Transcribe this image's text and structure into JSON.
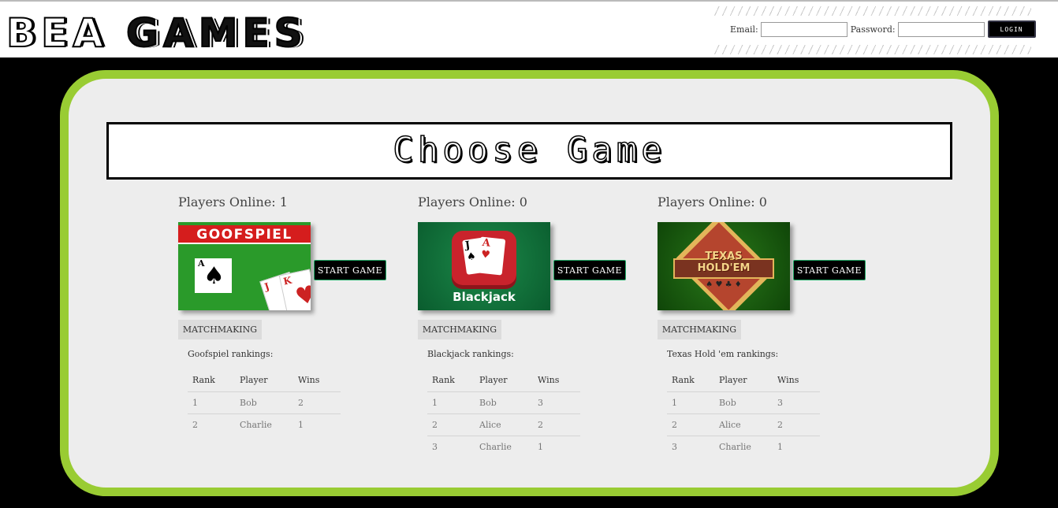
{
  "header": {
    "logo_text_1": "BEA",
    "logo_text_2": "GAMES",
    "email_label": "Email:",
    "email_value": "",
    "password_label": "Password:",
    "password_value": "",
    "login_button": "LOGIN"
  },
  "main": {
    "title": "Choose Game",
    "games": [
      {
        "players_online_label": "Players Online:",
        "players_online": "1",
        "thumbnail_text": "GOOFSPIEL",
        "start_button": "START GAME",
        "matchmaking_button": "MATCHMAKING",
        "rankings_title": "Goofspiel rankings:",
        "columns": [
          "Rank",
          "Player",
          "Wins"
        ],
        "rows": [
          [
            "1",
            "Bob",
            "2"
          ],
          [
            "2",
            "Charlie",
            "1"
          ]
        ]
      },
      {
        "players_online_label": "Players Online:",
        "players_online": "0",
        "thumbnail_text": "Blackjack",
        "start_button": "START GAME",
        "matchmaking_button": "MATCHMAKING",
        "rankings_title": "Blackjack rankings:",
        "columns": [
          "Rank",
          "Player",
          "Wins"
        ],
        "rows": [
          [
            "1",
            "Bob",
            "3"
          ],
          [
            "2",
            "Alice",
            "2"
          ],
          [
            "3",
            "Charlie",
            "1"
          ]
        ]
      },
      {
        "players_online_label": "Players Online:",
        "players_online": "0",
        "thumbnail_text_1": "TEXAS",
        "thumbnail_text_2": "HOLD'EM",
        "start_button": "START GAME",
        "matchmaking_button": "MATCHMAKING",
        "rankings_title": "Texas Hold 'em rankings:",
        "columns": [
          "Rank",
          "Player",
          "Wins"
        ],
        "rows": [
          [
            "1",
            "Bob",
            "3"
          ],
          [
            "2",
            "Alice",
            "2"
          ],
          [
            "3",
            "Charlie",
            "1"
          ]
        ]
      }
    ]
  },
  "colors": {
    "panel_border": "#99cc33",
    "panel_bg": "#ededed",
    "page_bg": "#000000"
  }
}
